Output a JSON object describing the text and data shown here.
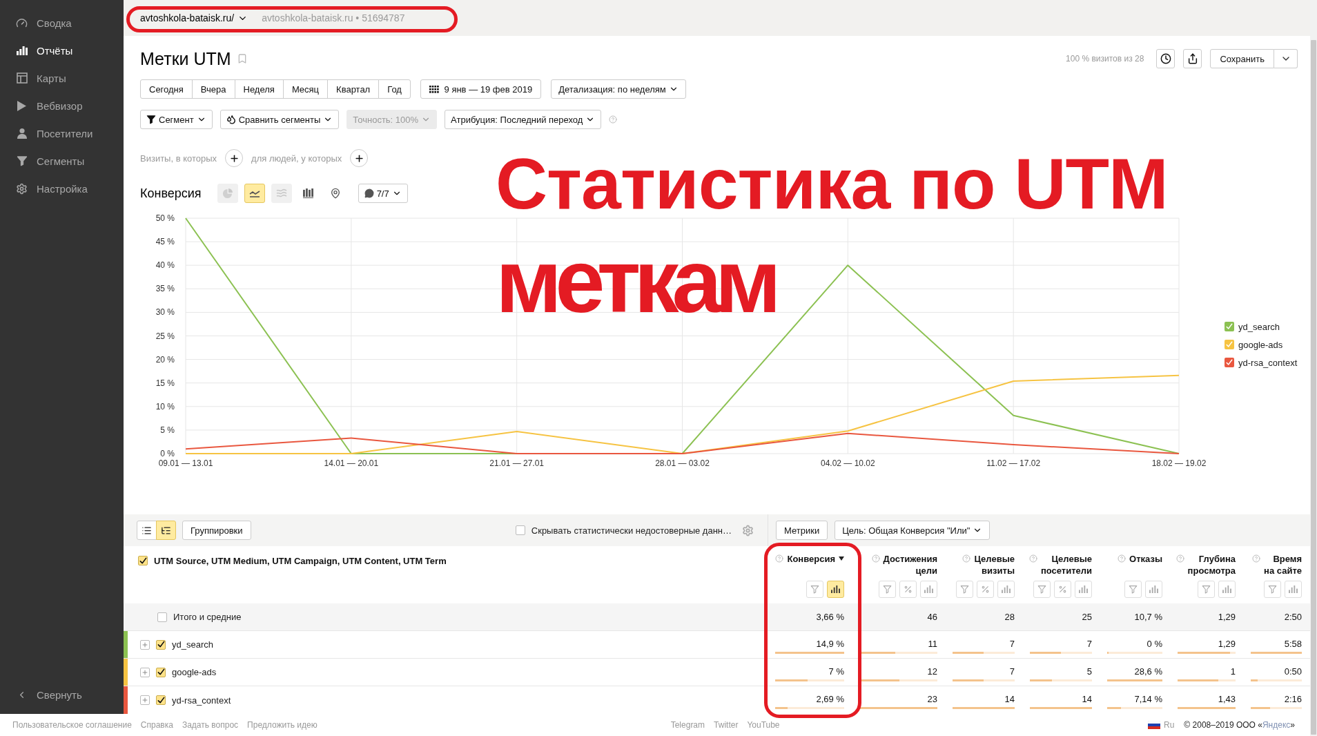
{
  "sidebar": {
    "items": [
      {
        "label": "Сводка",
        "selected": false
      },
      {
        "label": "Отчёты",
        "selected": true
      },
      {
        "label": "Карты",
        "selected": false
      },
      {
        "label": "Вебвизор",
        "selected": false
      },
      {
        "label": "Посетители",
        "selected": false
      },
      {
        "label": "Сегменты",
        "selected": false
      },
      {
        "label": "Настройка",
        "selected": false
      }
    ],
    "collapse": "Свернуть"
  },
  "top_bar": {
    "site": "avtoshkola-bataisk.ru/",
    "counter": "avtoshkola-bataisk.ru • 51694787"
  },
  "report": {
    "title": "Метки UTM",
    "bookmarked": false,
    "sample": "100 % визитов из 28",
    "save": "Сохранить"
  },
  "periods": [
    {
      "label": "Сегодня",
      "selected": false
    },
    {
      "label": "Вчера",
      "selected": false
    },
    {
      "label": "Неделя",
      "selected": false
    },
    {
      "label": "Месяц",
      "selected": false
    },
    {
      "label": "Квартал",
      "selected": false
    },
    {
      "label": "Год",
      "selected": false
    }
  ],
  "date_range": "9 янв — 19 фев 2019",
  "detail": "Детализация: по неделям",
  "filters": [
    {
      "kind": "segment",
      "label": "Сегмент",
      "disabled": false
    },
    {
      "kind": "compare",
      "label": "Сравнить сегменты",
      "disabled": false
    },
    {
      "kind": "plain",
      "label": "Точность: 100%",
      "disabled": true
    },
    {
      "kind": "plain",
      "label": "Атрибуция: Последний переход",
      "disabled": false
    }
  ],
  "conditions": {
    "visits": "Визиты, в которых",
    "people": "для людей, у которых"
  },
  "chart_panel": {
    "metric": "Конверсия",
    "chart_types": [
      {
        "selected": false,
        "disabled": true
      },
      {
        "selected": true,
        "disabled": false
      },
      {
        "selected": false,
        "disabled": true
      },
      {
        "selected": false,
        "disabled": false
      },
      {
        "selected": false,
        "disabled": false
      }
    ],
    "series_count": "7/7",
    "legend_items": [
      {
        "checked": true
      },
      {
        "checked": true
      },
      {
        "checked": true
      }
    ],
    "chart_data": {
      "type": "line",
      "categories": [
        "09.01 — 13.01",
        "14.01 — 20.01",
        "21.01 — 27.01",
        "28.01 — 03.02",
        "04.02 — 10.02",
        "11.02 — 17.02",
        "18.02 — 19.02"
      ],
      "series": [
        {
          "name": "yd_search",
          "color": "#8cc152",
          "values": [
            50,
            0,
            0,
            0,
            40,
            8.1,
            0
          ]
        },
        {
          "name": "google-ads",
          "color": "#f6c342",
          "values": [
            0,
            0,
            4.7,
            0,
            4.8,
            15.4,
            16.6
          ]
        },
        {
          "name": "yd-rsa_context",
          "color": "#e9573f",
          "values": [
            1,
            3.3,
            0,
            0,
            4.3,
            1.9,
            0
          ]
        }
      ],
      "ylim": [
        0,
        50
      ],
      "yticks": [
        {
          "value": 0,
          "label": "0 %"
        },
        {
          "value": 5,
          "label": "5 %"
        },
        {
          "value": 10,
          "label": "10 %"
        },
        {
          "value": 15,
          "label": "15 %"
        },
        {
          "value": 20,
          "label": "20 %"
        },
        {
          "value": 25,
          "label": "25 %"
        },
        {
          "value": 30,
          "label": "30 %"
        },
        {
          "value": 35,
          "label": "35 %"
        },
        {
          "value": 40,
          "label": "40 %"
        },
        {
          "value": 45,
          "label": "45 %"
        },
        {
          "value": 50,
          "label": "50 %"
        }
      ],
      "grid": true
    }
  },
  "annotation": {
    "lines": [
      "Статистика по UTM",
      "меткам"
    ]
  },
  "table": {
    "view_modes": [
      {
        "selected": false
      },
      {
        "selected": true
      }
    ],
    "groupings": "Группировки",
    "hide_unreliable": {
      "label": "Скрывать статистически недостоверные данн…",
      "checked": false
    },
    "metrics": "Метрики",
    "goal": "Цель: Общая Конверсия \"Или\"",
    "dimension": {
      "label": "UTM Source, UTM Medium, UTM Campaign, UTM Content, UTM Term",
      "checked": true
    },
    "columns": [
      {
        "title": "Конверсия",
        "sorted": true,
        "has_percent": false,
        "chart_selected": true
      },
      {
        "title": "Достижения\nцели",
        "sorted": false,
        "has_percent": true,
        "chart_selected": false
      },
      {
        "title": "Целевые\nвизиты",
        "sorted": false,
        "has_percent": true,
        "chart_selected": false
      },
      {
        "title": "Целевые\nпосетители",
        "sorted": false,
        "has_percent": true,
        "chart_selected": false
      },
      {
        "title": "Отказы",
        "sorted": false,
        "has_percent": false,
        "chart_selected": false
      },
      {
        "title": "Глубина\nпросмотра",
        "sorted": false,
        "has_percent": false,
        "chart_selected": false
      },
      {
        "title": "Время\nна сайте",
        "sorted": false,
        "has_percent": false,
        "chart_selected": false
      }
    ],
    "totals": {
      "label": "Итого и средние",
      "checked": false,
      "values": [
        "3,66 %",
        "46",
        "28",
        "25",
        "10,7 %",
        "1,29",
        "2:50"
      ]
    },
    "rows": [
      {
        "label": "yd_search",
        "color": "#8cc152",
        "checked": true,
        "cells": [
          {
            "value": "14,9 %",
            "level": 1
          },
          {
            "value": "11",
            "level": 0.46
          },
          {
            "value": "7",
            "level": 0.5
          },
          {
            "value": "7",
            "level": 0.5
          },
          {
            "value": "0 %",
            "level": 0
          },
          {
            "value": "1,29",
            "level": 0.9
          },
          {
            "value": "5:58",
            "level": 1
          }
        ]
      },
      {
        "label": "google-ads",
        "color": "#f6c342",
        "checked": true,
        "cells": [
          {
            "value": "7 %",
            "level": 0.47
          },
          {
            "value": "12",
            "level": 0.51
          },
          {
            "value": "7",
            "level": 0.5
          },
          {
            "value": "5",
            "level": 0.36
          },
          {
            "value": "28,6 %",
            "level": 1
          },
          {
            "value": "1",
            "level": 0.7
          },
          {
            "value": "0:50",
            "level": 0.14
          }
        ]
      },
      {
        "label": "yd-rsa_context",
        "color": "#e9573f",
        "checked": true,
        "cells": [
          {
            "value": "2,69 %",
            "level": 0.18
          },
          {
            "value": "23",
            "level": 1
          },
          {
            "value": "14",
            "level": 1
          },
          {
            "value": "14",
            "level": 1
          },
          {
            "value": "7,14 %",
            "level": 0.25
          },
          {
            "value": "1,43",
            "level": 1
          },
          {
            "value": "2:16",
            "level": 0.38
          }
        ]
      }
    ]
  },
  "footer": {
    "links": [
      "Пользовательское соглашение",
      "Справка",
      "Задать вопрос",
      "Предложить идею"
    ],
    "social": [
      "Telegram",
      "Twitter",
      "YouTube"
    ],
    "language": "Ru",
    "copyright": {
      "prefix": "© 2008–2019 ООО «",
      "link": "Яндекс",
      "suffix": "»"
    }
  }
}
